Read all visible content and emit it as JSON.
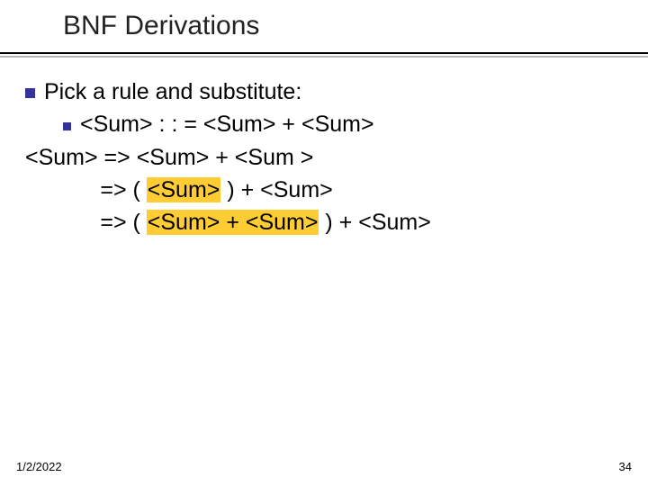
{
  "slide": {
    "title": "BNF Derivations",
    "line1": "Pick a rule and substitute:",
    "line2": "<Sum> : : = <Sum> + <Sum>",
    "line3_a": "<Sum> => <Sum> + <Sum >",
    "line4_a": "=> ( ",
    "line4_hl": "<Sum>",
    "line4_b": " ) + <Sum>",
    "line5_a": "=> ( ",
    "line5_hl": "<Sum> + <Sum>",
    "line5_b": " ) + <Sum>",
    "date": "1/2/2022",
    "page": "34"
  }
}
